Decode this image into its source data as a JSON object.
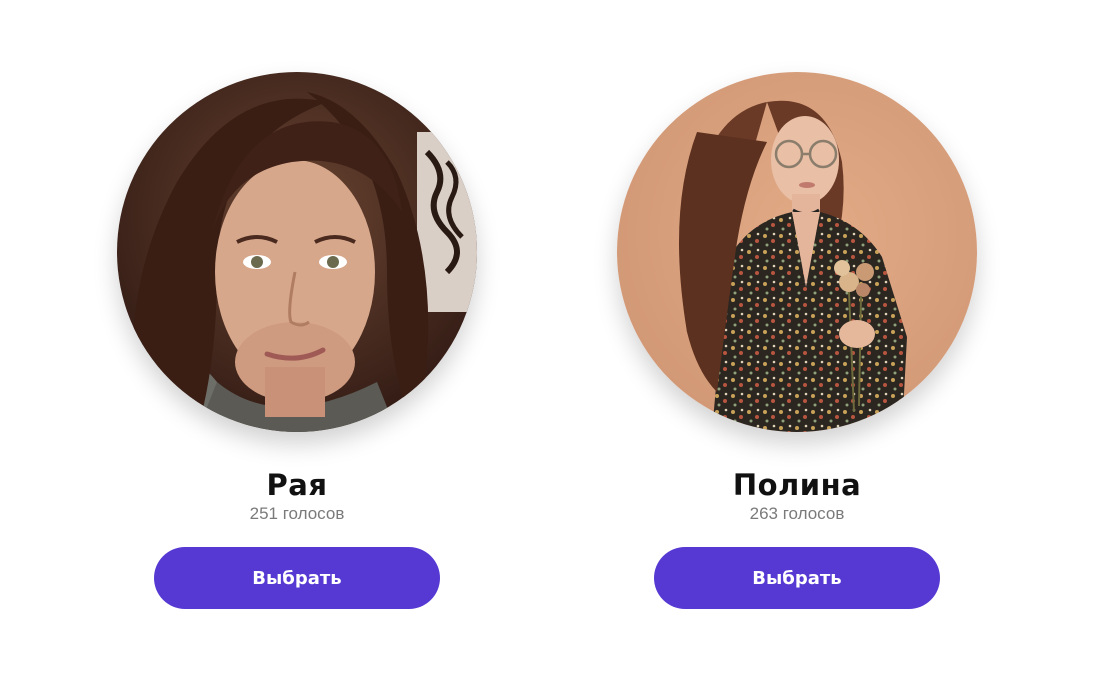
{
  "candidates": [
    {
      "name": "Рая",
      "votes": "251 голосов",
      "button_label": "Выбрать"
    },
    {
      "name": "Полина",
      "votes": "263 голосов",
      "button_label": "Выбрать"
    }
  ],
  "colors": {
    "button_bg": "#5639d3",
    "button_text": "#ffffff",
    "name_text": "#111111",
    "votes_text": "#7a7a7a"
  }
}
